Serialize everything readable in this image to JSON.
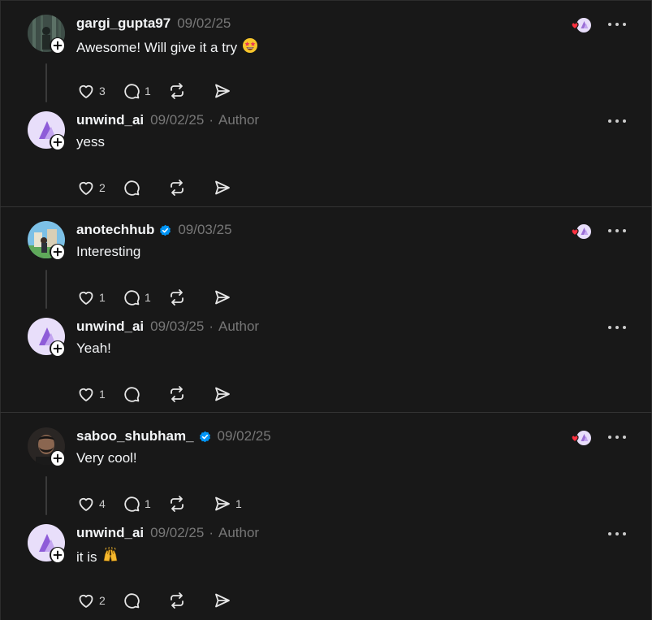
{
  "threads": [
    {
      "reply": {
        "username": "gargi_gupta97",
        "date": "09/02/25",
        "text": "Awesome! Will give it a try",
        "emoji": "star-struck-emoji",
        "likes": "3",
        "replies": "1",
        "reposts": "",
        "shares": "",
        "avatar_color": "#4b5a55",
        "verified": false
      },
      "author_reply": {
        "username": "unwind_ai",
        "date": "09/02/25",
        "author_label": "Author",
        "text": "yess",
        "likes": "2",
        "replies": "",
        "reposts": "",
        "shares": ""
      }
    },
    {
      "reply": {
        "username": "anotechhub",
        "date": "09/03/25",
        "text": "Interesting",
        "likes": "1",
        "replies": "1",
        "reposts": "",
        "shares": "",
        "avatar_color": "#6fb2d6",
        "verified": true
      },
      "author_reply": {
        "username": "unwind_ai",
        "date": "09/03/25",
        "author_label": "Author",
        "text": "Yeah!",
        "likes": "1",
        "replies": "",
        "reposts": "",
        "shares": ""
      }
    },
    {
      "reply": {
        "username": "saboo_shubham_",
        "date": "09/02/25",
        "text": "Very cool!",
        "likes": "4",
        "replies": "1",
        "reposts": "",
        "shares": "1",
        "avatar_color": "#3a3533",
        "verified": true
      },
      "author_reply": {
        "username": "unwind_ai",
        "date": "09/02/25",
        "author_label": "Author",
        "text": "it is",
        "emoji": "raising-hands-emoji",
        "likes": "2",
        "replies": "",
        "reposts": "",
        "shares": ""
      }
    }
  ],
  "colors": {
    "background": "#181818",
    "text": "#f3f5f7",
    "muted": "#777777",
    "verified_blue": "#0095f6",
    "brand_purple": "#9b6fd6",
    "heart_red": "#ff3040"
  },
  "icons": {
    "like": "heart-icon",
    "reply": "comment-icon",
    "repost": "repost-icon",
    "share": "send-icon",
    "more": "more-icon",
    "follow": "plus-icon",
    "verified": "verified-badge-icon"
  }
}
